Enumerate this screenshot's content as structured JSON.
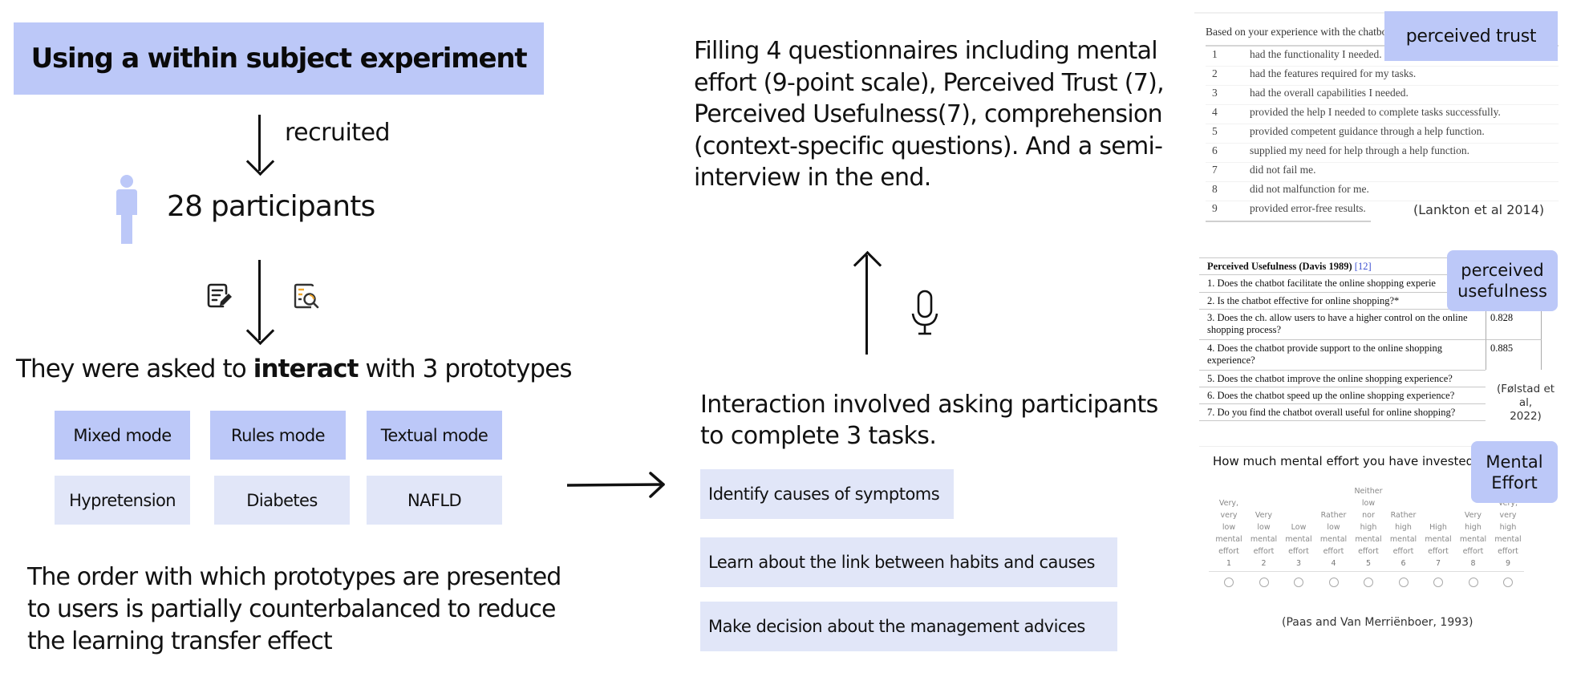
{
  "left": {
    "title": "Using a within subject experiment",
    "recruited_label": "recruited",
    "participants_label": "28 participants",
    "asked_prefix": "They were asked to ",
    "asked_bold": "interact",
    "asked_suffix": " with 3 prototypes",
    "modes": [
      "Mixed mode",
      "Rules mode",
      "Textual mode"
    ],
    "conditions": [
      "Hypretension",
      "Diabetes",
      "NAFLD"
    ],
    "order_text": "The order with which prototypes are presented to users is partially counterbalanced to reduce the learning transfer effect",
    "icons": [
      "person-icon",
      "edit-form-icon",
      "document-search-icon"
    ]
  },
  "middle": {
    "questionnaire_text": "Filling 4 questionnaires including mental effort (9-point scale), Perceived Trust (7),  Perceived Usefulness(7), comprehension (context-specific questions). And a semi-interview in the end.",
    "interaction_text": "Interaction involved asking participants to complete 3 tasks.",
    "tasks": [
      "Identify causes of symptoms",
      "Learn about the link between habits and causes",
      "Make decision about the management advices"
    ],
    "icons": [
      "microphone-icon"
    ]
  },
  "trust": {
    "label": "perceived trust",
    "intro": "Based on your experience with the chatbot it:",
    "items": [
      {
        "num": "1",
        "text": "had the functionality I needed."
      },
      {
        "num": "2",
        "text": "had the features required for my tasks."
      },
      {
        "num": "3",
        "text": "had the overall capabilities I needed."
      },
      {
        "num": "4",
        "text": "provided the help I needed to complete tasks successfully."
      },
      {
        "num": "5",
        "text": "provided competent guidance through a help function."
      },
      {
        "num": "6",
        "text": "supplied my need for help through a help function."
      },
      {
        "num": "7",
        "text": "did not fail me."
      },
      {
        "num": "8",
        "text": "did not malfunction for me."
      },
      {
        "num": "9",
        "text": "provided error-free results."
      }
    ],
    "citation": "(Lankton et al 2014)"
  },
  "usefulness": {
    "label_line1": "perceived",
    "label_line2": "usefulness",
    "header": "Perceived Usefulness (Davis 1989) ",
    "header_ref": "[12]",
    "items": [
      {
        "text": "1. Does the chatbot facilitate the online shopping experie",
        "value": ""
      },
      {
        "text": "2. Is the chatbot effective for online shopping?*",
        "value": ""
      },
      {
        "text": "3. Does the ch. allow users to have a higher control on the online shopping process?",
        "value": "0.828"
      },
      {
        "text": "4. Does the chatbot provide support to the online shopping experience?",
        "value": "0.885"
      },
      {
        "text": "5. Does the chatbot improve the online shopping experience?",
        "value": ""
      },
      {
        "text": "6. Does the chatbot speed up the online shopping experience?",
        "value": ""
      },
      {
        "text": "7. Do you find the chatbot overall useful for online shopping?",
        "value": ""
      }
    ],
    "citation_line1": "(Følstad et al,",
    "citation_line2": "2022)"
  },
  "mental_effort": {
    "label_line1": "Mental",
    "label_line2": "Effort",
    "question": "How much mental effort you have invested in",
    "scale": [
      {
        "label": [
          "Very,",
          "very",
          "low",
          "mental",
          "effort"
        ],
        "num": "1"
      },
      {
        "label": [
          "Very",
          "low",
          "mental",
          "effort"
        ],
        "num": "2"
      },
      {
        "label": [
          "Low",
          "mental",
          "effort"
        ],
        "num": "3"
      },
      {
        "label": [
          "Rather",
          "low",
          "mental",
          "effort"
        ],
        "num": "4"
      },
      {
        "label": [
          "Neither",
          "low",
          "nor",
          "high",
          "mental",
          "effort"
        ],
        "num": "5"
      },
      {
        "label": [
          "Rather",
          "high",
          "mental",
          "effort"
        ],
        "num": "6"
      },
      {
        "label": [
          "High",
          "mental",
          "effort"
        ],
        "num": "7"
      },
      {
        "label": [
          "Very",
          "high",
          "mental",
          "effort"
        ],
        "num": "8"
      },
      {
        "label": [
          "Very,",
          "very",
          "high",
          "mental",
          "effort"
        ],
        "num": "9"
      }
    ],
    "citation": "(Paas and Van Merriënboer, 1993)"
  },
  "colors": {
    "accent": "#bcc8f8",
    "light_accent": "#e1e6f8",
    "icon_orange": "#f0a830",
    "text": "#111111"
  }
}
